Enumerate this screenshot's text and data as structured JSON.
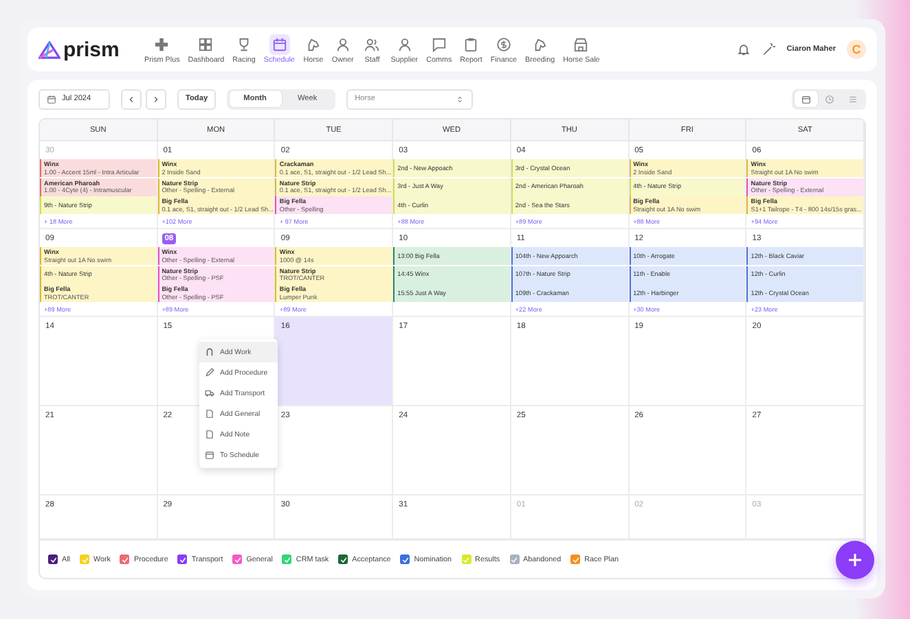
{
  "brand": "prism",
  "nav": [
    {
      "label": "Prism Plus",
      "selected": false
    },
    {
      "label": "Dashboard",
      "selected": false
    },
    {
      "label": "Racing",
      "selected": false
    },
    {
      "label": "Schedule",
      "selected": true
    },
    {
      "label": "Horse",
      "selected": false
    },
    {
      "label": "Owner",
      "selected": false
    },
    {
      "label": "Staff",
      "selected": false
    },
    {
      "label": "Supplier",
      "selected": false
    },
    {
      "label": "Comms",
      "selected": false
    },
    {
      "label": "Report",
      "selected": false
    },
    {
      "label": "Finance",
      "selected": false
    },
    {
      "label": "Breeding",
      "selected": false
    },
    {
      "label": "Horse Sale",
      "selected": false
    }
  ],
  "user": {
    "name": "Ciaron Maher",
    "initial": "C"
  },
  "toolbar": {
    "date": "Jul 2024",
    "today": "Today",
    "views": [
      {
        "label": "Month",
        "selected": true
      },
      {
        "label": "Week",
        "selected": false
      }
    ],
    "horse_select": {
      "placeholder": "Horse"
    },
    "layouts": [
      {
        "selected": true
      },
      {
        "selected": false
      },
      {
        "selected": false
      }
    ]
  },
  "weekdays": [
    "SUN",
    "MON",
    "TUE",
    "WED",
    "THU",
    "FRI",
    "SAT"
  ],
  "weeks": [
    [
      {
        "date": "30",
        "muted": true,
        "today": false,
        "selected": false,
        "more": "+ 18 More",
        "events": [
          {
            "kind": "procedure",
            "title": "Winx",
            "detail": "1.00 - Accent 15ml - Intra Articular"
          },
          {
            "kind": "procedure",
            "title": "American Pharoah",
            "detail": "1.00 - 4Cyte (4) - Intramuscular"
          },
          {
            "kind": "results",
            "title": "9th - Nature Strip"
          }
        ]
      },
      {
        "date": "01",
        "muted": false,
        "today": false,
        "selected": false,
        "more": "+102 More",
        "events": [
          {
            "kind": "work",
            "title": "Winx",
            "detail": "2 Inside Sand"
          },
          {
            "kind": "work",
            "title": "Nature Strip",
            "detail": "Other - Spelling - External"
          },
          {
            "kind": "work",
            "title": "Big Fella",
            "detail": "0.1 ace, S1, straight out - 1/2 Lead Sh..."
          }
        ]
      },
      {
        "date": "02",
        "muted": false,
        "today": false,
        "selected": false,
        "more": "+ 97 More",
        "events": [
          {
            "kind": "work",
            "title": "Crackaman",
            "detail": "0.1 ace, S1, straight out - 1/2 Lead Sh..."
          },
          {
            "kind": "work",
            "title": "Nature Strip",
            "detail": "0.1 ace, S1, straight out - 1/2 Lead Sh..."
          },
          {
            "kind": "general",
            "title": "Big Fella",
            "detail": "Other - Spelling"
          }
        ]
      },
      {
        "date": "03",
        "muted": false,
        "today": false,
        "selected": false,
        "more": "+88 More",
        "events": [
          {
            "kind": "results",
            "title": "2nd - New Appoach"
          },
          {
            "kind": "results",
            "title": "3rd - Just A Way"
          },
          {
            "kind": "results",
            "title": "4th - Curlin"
          }
        ]
      },
      {
        "date": "04",
        "muted": false,
        "today": false,
        "selected": false,
        "more": "+89 More",
        "events": [
          {
            "kind": "results",
            "title": "3rd - Crystal Ocean"
          },
          {
            "kind": "results",
            "title": "2nd - American Pharoah"
          },
          {
            "kind": "results",
            "title": "2nd - Sea the Stars"
          }
        ]
      },
      {
        "date": "05",
        "muted": false,
        "today": false,
        "selected": false,
        "more": "+88 More",
        "events": [
          {
            "kind": "work",
            "title": "Winx",
            "detail": "2 Inside Sand"
          },
          {
            "kind": "results",
            "title": "4th - Nature Strip"
          },
          {
            "kind": "work",
            "title": "Big Fella",
            "detail": "Straight out 1A No swim"
          }
        ]
      },
      {
        "date": "06",
        "muted": false,
        "today": false,
        "selected": false,
        "more": "+94 More",
        "events": [
          {
            "kind": "work",
            "title": "Winx",
            "detail": "Straight out 1A No swim"
          },
          {
            "kind": "general",
            "title": "Nature Strip",
            "detail": "Other - Spelling - External"
          },
          {
            "kind": "work",
            "title": "Big Fella",
            "detail": "S1+1 Tailrope - T4 - 800 14s/15s gras..."
          }
        ]
      }
    ],
    [
      {
        "date": "09",
        "muted": false,
        "today": false,
        "selected": false,
        "more": "+89 More",
        "events": [
          {
            "kind": "work",
            "title": "Winx",
            "detail": "Straight out 1A No swim"
          },
          {
            "kind": "work",
            "title": "4th - Nature Strip"
          },
          {
            "kind": "work",
            "title": "Big Fella",
            "detail": "TROT/CANTER"
          }
        ]
      },
      {
        "date": "08",
        "muted": false,
        "today": true,
        "selected": false,
        "more": "+89 More",
        "events": [
          {
            "kind": "general",
            "title": "Winx",
            "detail": "Other - Spelling - External"
          },
          {
            "kind": "general",
            "title": "Nature Strip",
            "detail": "Other - Spelling - PSF"
          },
          {
            "kind": "general",
            "title": "Big Fella",
            "detail": "Other - Spelling - PSF"
          }
        ]
      },
      {
        "date": "09",
        "muted": false,
        "today": false,
        "selected": false,
        "more": "+89 More",
        "events": [
          {
            "kind": "work",
            "title": "Winx",
            "detail": "1000 @ 14s"
          },
          {
            "kind": "work",
            "title": "Nature Strip",
            "detail": "TROT/CANTER"
          },
          {
            "kind": "work",
            "title": "Big Fella",
            "detail": "Lumper Punk"
          }
        ]
      },
      {
        "date": "10",
        "muted": false,
        "today": false,
        "selected": false,
        "events": [
          {
            "kind": "acceptance",
            "title": "13:00 Big Fella"
          },
          {
            "kind": "acceptance",
            "title": "14:45 Winx"
          },
          {
            "kind": "acceptance",
            "title": "15:55 Just A Way"
          }
        ]
      },
      {
        "date": "11",
        "muted": false,
        "today": false,
        "selected": false,
        "more": "+22 More",
        "events": [
          {
            "kind": "nomination",
            "title": "104th - New Appoarch"
          },
          {
            "kind": "nomination",
            "title": "107th - Nature Strip"
          },
          {
            "kind": "nomination",
            "title": "109th - Crackaman"
          }
        ]
      },
      {
        "date": "12",
        "muted": false,
        "today": false,
        "selected": false,
        "more": "+30 More",
        "events": [
          {
            "kind": "nomination",
            "title": "10th - Arrogate"
          },
          {
            "kind": "nomination",
            "title": "11th - Enable"
          },
          {
            "kind": "nomination",
            "title": "12th - Harbinger"
          }
        ]
      },
      {
        "date": "13",
        "muted": false,
        "today": false,
        "selected": false,
        "more": "+23 More",
        "events": [
          {
            "kind": "nomination",
            "title": "12th - Black Caviar"
          },
          {
            "kind": "nomination",
            "title": "12th - Curlin"
          },
          {
            "kind": "nomination",
            "title": "12th - Crystal Ocean"
          }
        ]
      }
    ],
    [
      {
        "date": "14",
        "muted": false,
        "today": false,
        "selected": false
      },
      {
        "date": "15",
        "muted": false,
        "today": false,
        "selected": false
      },
      {
        "date": "16",
        "muted": false,
        "today": false,
        "selected": true
      },
      {
        "date": "17",
        "muted": false,
        "today": false,
        "selected": false
      },
      {
        "date": "18",
        "muted": false,
        "today": false,
        "selected": false
      },
      {
        "date": "19",
        "muted": false,
        "today": false,
        "selected": false
      },
      {
        "date": "20",
        "muted": false,
        "today": false,
        "selected": false
      }
    ],
    [
      {
        "date": "21",
        "muted": false,
        "today": false,
        "selected": false
      },
      {
        "date": "22",
        "muted": false,
        "today": false,
        "selected": false
      },
      {
        "date": "23",
        "muted": false,
        "today": false,
        "selected": false
      },
      {
        "date": "24",
        "muted": false,
        "today": false,
        "selected": false
      },
      {
        "date": "25",
        "muted": false,
        "today": false,
        "selected": false
      },
      {
        "date": "26",
        "muted": false,
        "today": false,
        "selected": false
      },
      {
        "date": "27",
        "muted": false,
        "today": false,
        "selected": false
      }
    ],
    [
      {
        "date": "28",
        "muted": false,
        "today": false,
        "selected": false
      },
      {
        "date": "29",
        "muted": false,
        "today": false,
        "selected": false
      },
      {
        "date": "30",
        "muted": false,
        "today": false,
        "selected": false
      },
      {
        "date": "31",
        "muted": false,
        "today": false,
        "selected": false
      },
      {
        "date": "01",
        "muted": true,
        "today": false,
        "selected": false
      },
      {
        "date": "02",
        "muted": true,
        "today": false,
        "selected": false
      },
      {
        "date": "03",
        "muted": true,
        "today": false,
        "selected": false
      }
    ]
  ],
  "context_menu": [
    {
      "label": "Add Work",
      "selected": true
    },
    {
      "label": "Add Procedure",
      "selected": false
    },
    {
      "label": "Add Transport",
      "selected": false
    },
    {
      "label": "Add General",
      "selected": false
    },
    {
      "label": "Add Note",
      "selected": false
    },
    {
      "label": "To Schedule",
      "selected": false
    }
  ],
  "legend": [
    {
      "label": "All",
      "color": "#4a1f7c",
      "checked": true
    },
    {
      "label": "Work",
      "color": "#f7d21c",
      "checked": true
    },
    {
      "label": "Procedure",
      "color": "#ef6a72",
      "checked": true
    },
    {
      "label": "Transport",
      "color": "#8a3cf6",
      "checked": true
    },
    {
      "label": "General",
      "color": "#f25ac9",
      "checked": true
    },
    {
      "label": "CRM task",
      "color": "#2fd67a",
      "checked": true
    },
    {
      "label": "Acceptance",
      "color": "#1a6a37",
      "checked": true
    },
    {
      "label": "Nomination",
      "color": "#3b6edf",
      "checked": true
    },
    {
      "label": "Results",
      "color": "#d7ea29",
      "checked": true
    },
    {
      "label": "Abandoned",
      "color": "#a9b1be",
      "checked": true
    },
    {
      "label": "Race Plan",
      "color": "#f5901d",
      "checked": true
    }
  ]
}
